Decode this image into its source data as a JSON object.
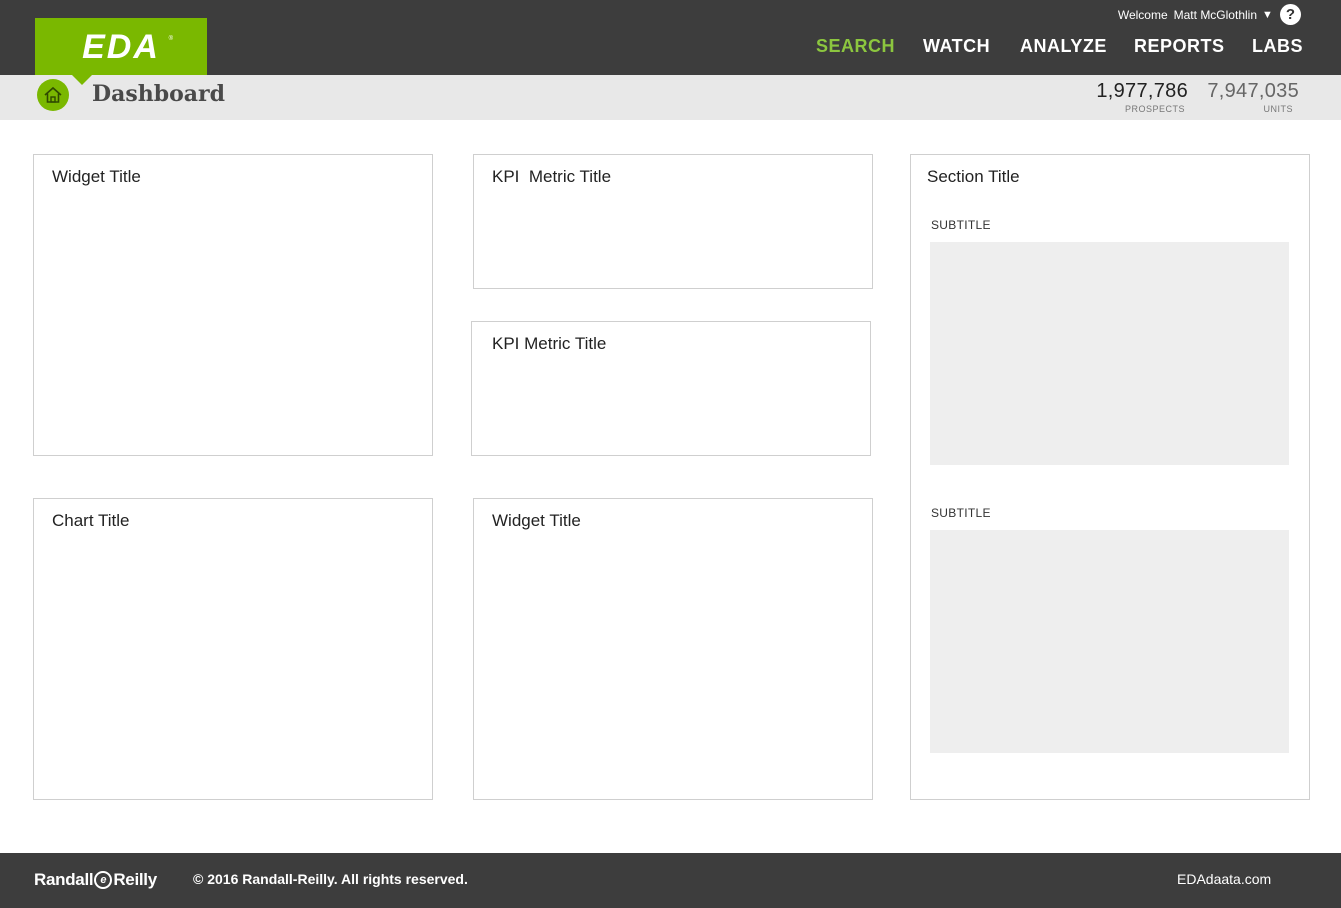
{
  "header": {
    "logo_text": "EDA",
    "welcome_label": "Welcome",
    "user_name": "Matt McGlothlin",
    "user_caret": "▼",
    "help_label": "?",
    "nav": [
      {
        "label": "SEARCH",
        "active": true
      },
      {
        "label": "WATCH",
        "active": false
      },
      {
        "label": "ANALYZE",
        "active": false
      },
      {
        "label": "REPORTS",
        "active": false
      },
      {
        "label": "LABS",
        "active": false
      }
    ]
  },
  "subheader": {
    "page_title": "Dashboard",
    "stats": [
      {
        "value": "1,977,786",
        "label": "PROSPECTS"
      },
      {
        "value": "7,947,035",
        "label": "UNITS"
      }
    ]
  },
  "cards": {
    "widget_1": {
      "title": "Widget Title"
    },
    "kpi_1": {
      "title": "KPI  Metric Title"
    },
    "kpi_2": {
      "title": "KPI Metric Title"
    },
    "chart_1": {
      "title": "Chart Title"
    },
    "widget_2": {
      "title": "Widget Title"
    },
    "section": {
      "title": "Section Title",
      "subtitles": [
        "SUBTITLE",
        "SUBTITLE"
      ]
    }
  },
  "footer": {
    "brand_left": "Randall",
    "brand_mark": "e",
    "brand_right": "Reilly",
    "copyright": "©  2016 Randall-Reilly. All rights reserved.",
    "site_link": "EDAdaata.com"
  },
  "colors": {
    "brand_green": "#7ab800",
    "active_nav": "#8cc63f",
    "header_bg": "#3d3d3d",
    "subbar_bg": "#e8e8e8",
    "placeholder": "#eeeeee"
  }
}
